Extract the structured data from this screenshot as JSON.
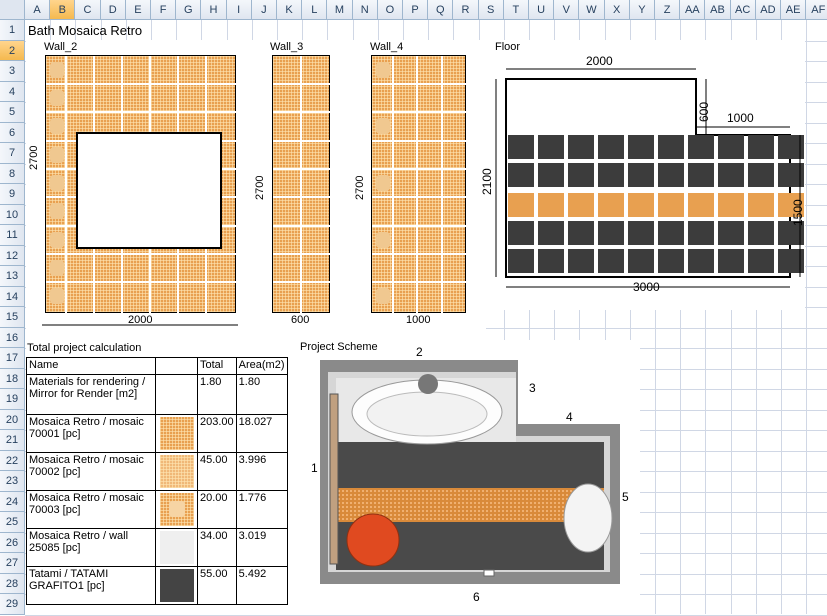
{
  "columns": [
    "A",
    "B",
    "C",
    "D",
    "E",
    "F",
    "G",
    "H",
    "I",
    "J",
    "K",
    "L",
    "M",
    "N",
    "O",
    "P",
    "Q",
    "R",
    "S",
    "T",
    "U",
    "V",
    "W",
    "X",
    "Y",
    "Z",
    "AA",
    "AB",
    "AC",
    "AD",
    "AE",
    "AF"
  ],
  "rows": [
    "1",
    "2",
    "3",
    "4",
    "5",
    "6",
    "7",
    "8",
    "9",
    "10",
    "11",
    "12",
    "13",
    "14",
    "15",
    "16",
    "17",
    "18",
    "19",
    "20",
    "21",
    "22",
    "23",
    "24",
    "25",
    "26",
    "27",
    "28",
    "29"
  ],
  "sheet_title": "Bath Mosaica Retro",
  "walls": {
    "wall2": {
      "label": "Wall_2",
      "height": "2700",
      "width": "2000"
    },
    "wall3": {
      "label": "Wall_3",
      "height": "2700",
      "width": "600"
    },
    "wall4": {
      "label": "Wall_4",
      "height": "2700",
      "width": "1000"
    }
  },
  "floor": {
    "label": "Floor",
    "top_width": "2000",
    "notch_depth": "600",
    "notch_width": "1000",
    "left_height": "2100",
    "right_height": "1500",
    "bottom_width": "3000",
    "colors": {
      "dark": "#3c3c3c",
      "orange": "#e8a050"
    }
  },
  "calc": {
    "title": "Total project calculation",
    "headers": {
      "name": "Name",
      "total": "Total",
      "area": "Area(m2)"
    },
    "rows": [
      {
        "name": "Materials for rendering / Mirror for Render [m2]",
        "total": "1.80",
        "area": "1.80",
        "swatch": "none"
      },
      {
        "name": "Mosaica Retro / mosaic 70001 [pc]",
        "total": "203.00",
        "area": "18.027",
        "swatch": "mosaic-orange"
      },
      {
        "name": "Mosaica Retro / mosaic 70002 [pc]",
        "total": "45.00",
        "area": "3.996",
        "swatch": "mosaic-light"
      },
      {
        "name": "Mosaica Retro / mosaic 70003 [pc]",
        "total": "20.00",
        "area": "1.776",
        "swatch": "mosaic-square"
      },
      {
        "name": "Mosaica Retro / wall 25085 [pc]",
        "total": "34.00",
        "area": "3.019",
        "swatch": "light-grey"
      },
      {
        "name": "Tatami / TATAMI GRAFITO1 [pc]",
        "total": "55.00",
        "area": "5.492",
        "swatch": "dark-grey"
      }
    ]
  },
  "scheme": {
    "title": "Project Scheme",
    "side_labels": [
      "1",
      "2",
      "3",
      "4",
      "5",
      "6"
    ]
  }
}
